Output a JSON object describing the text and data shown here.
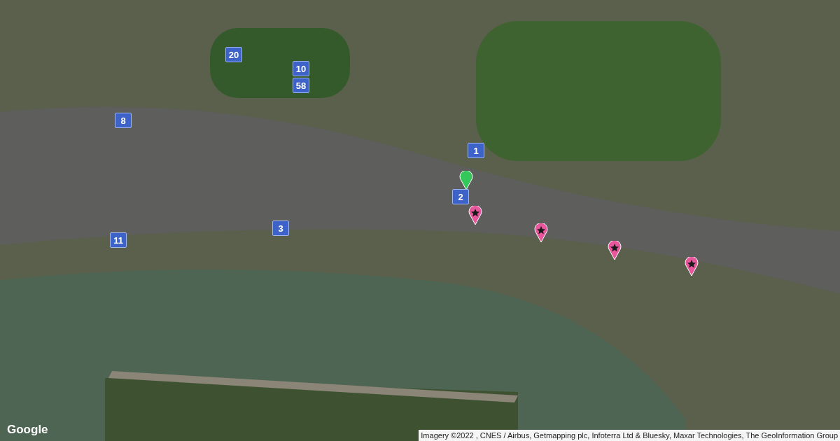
{
  "map": {
    "markers": [
      {
        "kind": "numbered",
        "label": "20"
      },
      {
        "kind": "numbered",
        "label": "10"
      },
      {
        "kind": "numbered",
        "label": "58"
      },
      {
        "kind": "numbered",
        "label": "8"
      },
      {
        "kind": "numbered",
        "label": "1"
      },
      {
        "kind": "dot",
        "color": "#34c759"
      },
      {
        "kind": "numbered",
        "label": "2"
      },
      {
        "kind": "numbered",
        "label": "3"
      },
      {
        "kind": "numbered",
        "label": "11"
      },
      {
        "kind": "star",
        "color": "#e8569c"
      },
      {
        "kind": "star",
        "color": "#e8569c"
      },
      {
        "kind": "star",
        "color": "#e8569c"
      },
      {
        "kind": "star",
        "color": "#e8569c"
      }
    ]
  },
  "logo": "Google",
  "attribution": "Imagery ©2022 , CNES / Airbus, Getmapping plc, Infoterra Ltd & Bluesky, Maxar Technologies, The GeoInformation Group"
}
